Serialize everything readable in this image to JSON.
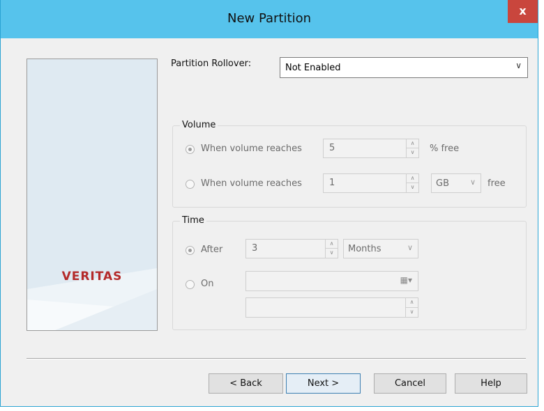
{
  "window": {
    "title": "New Partition",
    "close_label": "x"
  },
  "brand": {
    "logo_text": "VERITAS"
  },
  "rollover": {
    "label": "Partition Rollover:",
    "value": "Not Enabled"
  },
  "volume": {
    "legend": "Volume",
    "row1": {
      "label": "When volume reaches",
      "value": "5",
      "unit": "% free",
      "selected": true
    },
    "row2": {
      "label": "When volume reaches",
      "value": "1",
      "unit_select": "GB",
      "suffix": "free",
      "selected": false
    }
  },
  "time": {
    "legend": "Time",
    "after": {
      "label": "After",
      "value": "3",
      "period": "Months",
      "selected": true
    },
    "on": {
      "label": "On",
      "date": "",
      "time": "",
      "selected": false
    }
  },
  "buttons": {
    "back": "< Back",
    "next": "Next >",
    "cancel": "Cancel",
    "help": "Help"
  },
  "icons": {
    "close": "close-icon",
    "dropdown": "chevron-down-icon",
    "calendar": "calendar-icon",
    "spinner": "spinner-arrows-icon"
  }
}
